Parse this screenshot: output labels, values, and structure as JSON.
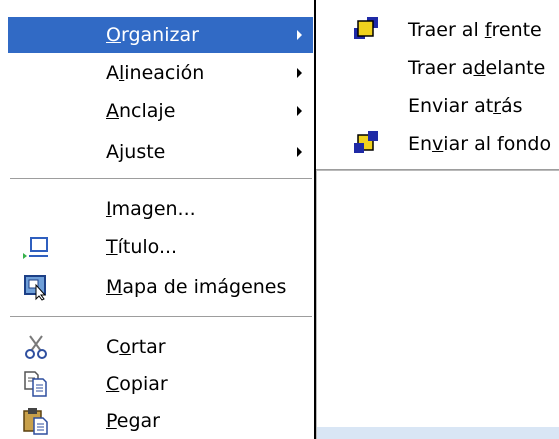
{
  "menu": {
    "items": [
      {
        "id": "organizar",
        "prefix": "",
        "mnemonic": "O",
        "suffix": "rganizar",
        "has_submenu": true,
        "highlighted": true
      },
      {
        "id": "alineacion",
        "prefix": "A",
        "mnemonic": "l",
        "suffix": "ineación",
        "has_submenu": true
      },
      {
        "id": "anclaje",
        "prefix": "",
        "mnemonic": "A",
        "suffix": "nclaje",
        "has_submenu": true
      },
      {
        "id": "ajuste",
        "prefix": "A",
        "mnemonic": "j",
        "suffix": "uste",
        "has_submenu": true
      },
      {
        "id": "imagen",
        "prefix": "",
        "mnemonic": "I",
        "suffix": "magen...",
        "icon": "none"
      },
      {
        "id": "titulo",
        "prefix": "",
        "mnemonic": "T",
        "suffix": "ítulo...",
        "icon": "caption-icon"
      },
      {
        "id": "mapa",
        "prefix": "",
        "mnemonic": "M",
        "suffix": "apa de imágenes",
        "icon": "image-map-icon"
      },
      {
        "id": "cortar",
        "prefix": "C",
        "mnemonic": "o",
        "suffix": "rtar",
        "icon": "scissors-icon"
      },
      {
        "id": "copiar",
        "prefix": "",
        "mnemonic": "C",
        "suffix": "opiar",
        "icon": "copy-icon"
      },
      {
        "id": "pegar",
        "prefix": "",
        "mnemonic": "P",
        "suffix": "egar",
        "icon": "paste-icon"
      }
    ]
  },
  "submenu": {
    "items": [
      {
        "id": "traer-al-frente",
        "prefix": "Traer al ",
        "mnemonic": "f",
        "suffix": "rente",
        "icon": "bring-to-front-icon"
      },
      {
        "id": "traer-adelante",
        "prefix": "Traer a",
        "mnemonic": "d",
        "suffix": "elante",
        "icon": "none"
      },
      {
        "id": "enviar-atras",
        "prefix": "Enviar at",
        "mnemonic": "r",
        "suffix": "ás",
        "icon": "none"
      },
      {
        "id": "enviar-al-fondo",
        "prefix": "En",
        "mnemonic": "v",
        "suffix": "iar al fondo",
        "icon": "send-to-back-icon"
      }
    ]
  },
  "colors": {
    "highlight": "#316ac5",
    "highlight_text": "#ffffff",
    "separator": "#9d9d9d",
    "doc_strip": "#d9e6f5"
  }
}
